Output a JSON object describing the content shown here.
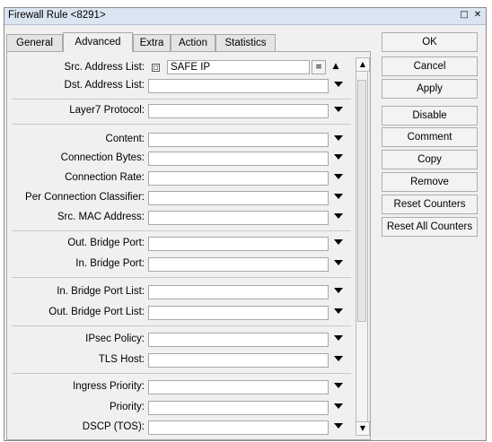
{
  "window": {
    "title": "Firewall Rule <8291>",
    "restore_glyph": "□",
    "close_glyph": "✕"
  },
  "tabs": [
    {
      "label": "General"
    },
    {
      "label": "Advanced"
    },
    {
      "label": "Extra"
    },
    {
      "label": "Action"
    },
    {
      "label": "Statistics"
    }
  ],
  "active_tab": "Advanced",
  "fields": {
    "src_address_list": {
      "label": "Src. Address List:",
      "value": "SAFE IP",
      "negate_checked": false
    },
    "dst_address_list": {
      "label": "Dst. Address List:",
      "value": ""
    },
    "layer7_protocol": {
      "label": "Layer7 Protocol:",
      "value": ""
    },
    "content": {
      "label": "Content:",
      "value": ""
    },
    "connection_bytes": {
      "label": "Connection Bytes:",
      "value": ""
    },
    "connection_rate": {
      "label": "Connection Rate:",
      "value": ""
    },
    "per_connection_classifier": {
      "label": "Per Connection Classifier:",
      "value": ""
    },
    "src_mac_address": {
      "label": "Src. MAC Address:",
      "value": ""
    },
    "out_bridge_port": {
      "label": "Out. Bridge Port:",
      "value": ""
    },
    "in_bridge_port": {
      "label": "In. Bridge Port:",
      "value": ""
    },
    "in_bridge_port_list": {
      "label": "In. Bridge Port List:",
      "value": ""
    },
    "out_bridge_port_list": {
      "label": "Out. Bridge Port List:",
      "value": ""
    },
    "ipsec_policy": {
      "label": "IPsec Policy:",
      "value": ""
    },
    "tls_host": {
      "label": "TLS Host:",
      "value": ""
    },
    "ingress_priority": {
      "label": "Ingress Priority:",
      "value": ""
    },
    "priority": {
      "label": "Priority:",
      "value": ""
    },
    "dscp_tos": {
      "label": "DSCP (TOS):",
      "value": ""
    }
  },
  "glyphs": {
    "down_small": "▼",
    "up_small": "▲",
    "list_menu": "≡"
  },
  "buttons": {
    "ok": "OK",
    "cancel": "Cancel",
    "apply": "Apply",
    "disable": "Disable",
    "comment": "Comment",
    "copy": "Copy",
    "remove": "Remove",
    "reset_counters": "Reset Counters",
    "reset_all_counters": "Reset All Counters"
  }
}
